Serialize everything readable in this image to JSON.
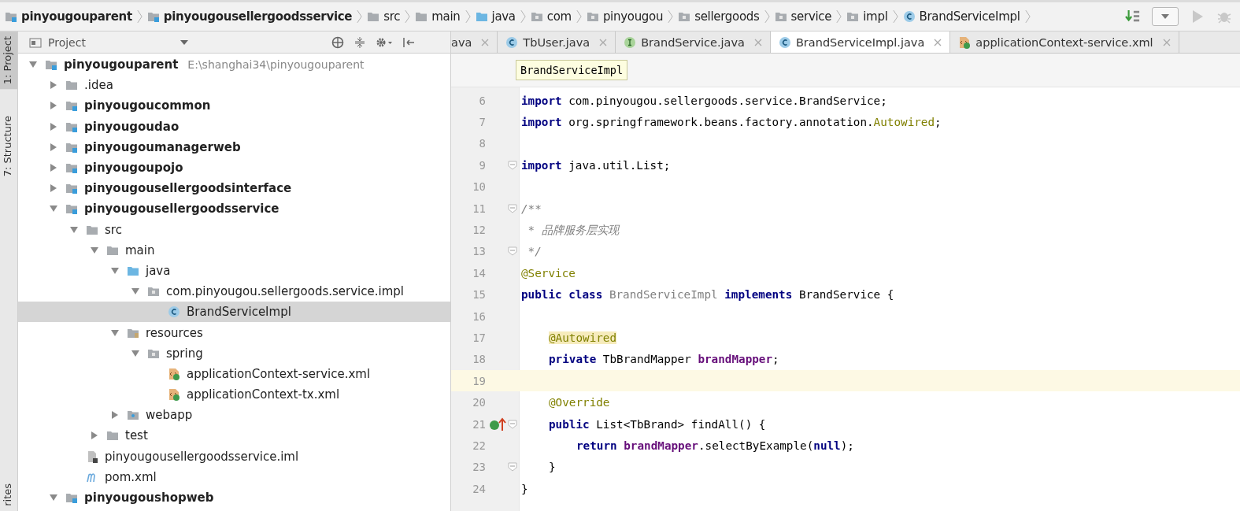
{
  "breadcrumbs": [
    {
      "label": "pinyougouparent",
      "kind": "module",
      "bold": true
    },
    {
      "label": "pinyougousellergoodsservice",
      "kind": "module",
      "bold": true
    },
    {
      "label": "src",
      "kind": "folder",
      "bold": false
    },
    {
      "label": "main",
      "kind": "folder",
      "bold": false
    },
    {
      "label": "java",
      "kind": "source",
      "bold": false
    },
    {
      "label": "com",
      "kind": "package",
      "bold": false
    },
    {
      "label": "pinyougou",
      "kind": "package",
      "bold": false
    },
    {
      "label": "sellergoods",
      "kind": "package",
      "bold": false
    },
    {
      "label": "service",
      "kind": "package",
      "bold": false
    },
    {
      "label": "impl",
      "kind": "package",
      "bold": false
    },
    {
      "label": "BrandServiceImpl",
      "kind": "class",
      "bold": false
    }
  ],
  "side_tool_tabs": [
    {
      "label": "1: Project",
      "selected": true
    },
    {
      "label": "7: Structure",
      "selected": false
    },
    {
      "label": "rites",
      "selected": false
    }
  ],
  "project_panel": {
    "title": "Project"
  },
  "tree": [
    {
      "label": "pinyougouparent",
      "path": "E:\\shanghai34\\pinyougouparent",
      "kind": "module",
      "bold": true,
      "expanded": true,
      "selected": false,
      "children": [
        {
          "label": ".idea",
          "kind": "folder",
          "bold": false,
          "expanded": false,
          "selected": false
        },
        {
          "label": "pinyougoucommon",
          "kind": "module",
          "bold": true,
          "expanded": false,
          "selected": false
        },
        {
          "label": "pinyougoudao",
          "kind": "module",
          "bold": true,
          "expanded": false,
          "selected": false
        },
        {
          "label": "pinyougoumanagerweb",
          "kind": "module",
          "bold": true,
          "expanded": false,
          "selected": false
        },
        {
          "label": "pinyougoupojo",
          "kind": "module",
          "bold": true,
          "expanded": false,
          "selected": false
        },
        {
          "label": "pinyougousellergoodsinterface",
          "kind": "module",
          "bold": true,
          "expanded": false,
          "selected": false
        },
        {
          "label": "pinyougousellergoodsservice",
          "kind": "module",
          "bold": true,
          "expanded": true,
          "selected": false,
          "children": [
            {
              "label": "src",
              "kind": "folder",
              "bold": false,
              "expanded": true,
              "selected": false,
              "children": [
                {
                  "label": "main",
                  "kind": "folder",
                  "bold": false,
                  "expanded": true,
                  "selected": false,
                  "children": [
                    {
                      "label": "java",
                      "kind": "source",
                      "bold": false,
                      "expanded": true,
                      "selected": false,
                      "children": [
                        {
                          "label": "com.pinyougou.sellergoods.service.impl",
                          "kind": "package",
                          "bold": false,
                          "expanded": true,
                          "selected": false,
                          "children": [
                            {
                              "label": "BrandServiceImpl",
                              "kind": "class",
                              "bold": false,
                              "selected": true
                            }
                          ]
                        }
                      ]
                    },
                    {
                      "label": "resources",
                      "kind": "resources",
                      "bold": false,
                      "expanded": true,
                      "selected": false,
                      "children": [
                        {
                          "label": "spring",
                          "kind": "package",
                          "bold": false,
                          "expanded": true,
                          "selected": false,
                          "children": [
                            {
                              "label": "applicationContext-service.xml",
                              "kind": "xml",
                              "bold": false,
                              "selected": false
                            },
                            {
                              "label": "applicationContext-tx.xml",
                              "kind": "xml",
                              "bold": false,
                              "selected": false
                            }
                          ]
                        }
                      ]
                    },
                    {
                      "label": "webapp",
                      "kind": "web",
                      "bold": false,
                      "expanded": false,
                      "selected": false
                    }
                  ]
                },
                {
                  "label": "test",
                  "kind": "folder",
                  "bold": false,
                  "expanded": false,
                  "selected": false
                }
              ]
            },
            {
              "label": "pinyougousellergoodsservice.iml",
              "kind": "iml",
              "bold": false,
              "selected": false
            },
            {
              "label": "pom.xml",
              "kind": "maven",
              "bold": false,
              "selected": false
            }
          ]
        },
        {
          "label": "pinyougoushopweb",
          "kind": "module",
          "bold": true,
          "expanded": true,
          "selected": false
        }
      ]
    }
  ],
  "tabs": [
    {
      "label": "ava",
      "selected": false
    },
    {
      "label": "TbUser.java",
      "kind": "class",
      "selected": false
    },
    {
      "label": "BrandService.java",
      "kind": "interface",
      "selected": false
    },
    {
      "label": "BrandServiceImpl.java",
      "kind": "class",
      "selected": true
    },
    {
      "label": "applicationContext-service.xml",
      "kind": "xml",
      "selected": false
    }
  ],
  "editor_breadcrumb": "BrandServiceImpl",
  "code_lines": [
    {
      "number": "6",
      "kind": "top",
      "fold": false,
      "current": false,
      "gutter_mark": false,
      "tokens": [
        {
          "kind": "keyword",
          "text": "import"
        },
        {
          "kind": "plain",
          "text": " com.pinyougou.sellergoods.service.BrandService;"
        }
      ]
    },
    {
      "number": "7",
      "kind": "top",
      "fold": false,
      "current": false,
      "gutter_mark": false,
      "tokens": [
        {
          "kind": "keyword",
          "text": "import"
        },
        {
          "kind": "plain",
          "text": " org.springframework.beans.factory.annotation."
        },
        {
          "kind": "annotation",
          "text": "Autowired"
        },
        {
          "kind": "plain",
          "text": ";"
        }
      ]
    },
    {
      "number": "8",
      "fold": false,
      "current": false,
      "gutter_mark": false
    },
    {
      "number": "9",
      "kind": "top",
      "fold": true,
      "current": false,
      "gutter_mark": false,
      "tokens": [
        {
          "kind": "keyword",
          "text": "import"
        },
        {
          "kind": "plain",
          "text": " java.util.List;"
        }
      ]
    },
    {
      "number": "10",
      "fold": false,
      "current": false,
      "gutter_mark": false
    },
    {
      "number": "11",
      "kind": "top",
      "fold": true,
      "current": false,
      "gutter_mark": false,
      "tokens": [
        {
          "kind": "comment",
          "text": "/**"
        }
      ]
    },
    {
      "number": "12",
      "kind": "top",
      "fold": false,
      "current": false,
      "gutter_mark": false,
      "tokens": [
        {
          "kind": "comment",
          "text": " * 品牌服务层实现"
        }
      ]
    },
    {
      "number": "13",
      "kind": "top",
      "fold": true,
      "current": false,
      "gutter_mark": false,
      "tokens": [
        {
          "kind": "comment",
          "text": " */"
        }
      ]
    },
    {
      "number": "14",
      "kind": "top",
      "fold": false,
      "current": false,
      "gutter_mark": false,
      "tokens": [
        {
          "kind": "annotation",
          "text": "@Service"
        }
      ]
    },
    {
      "number": "15",
      "kind": "top",
      "fold": false,
      "current": false,
      "gutter_mark": false,
      "tokens": [
        {
          "kind": "keyword",
          "text": "public class"
        },
        {
          "kind": "unused",
          "text": " BrandServiceImpl "
        },
        {
          "kind": "keyword",
          "text": "implements"
        },
        {
          "kind": "plain",
          "text": " BrandService {"
        }
      ]
    },
    {
      "number": "16",
      "fold": false,
      "current": false,
      "gutter_mark": false
    },
    {
      "number": "17",
      "kind": "member",
      "fold": false,
      "current": false,
      "gutter_mark": false,
      "tokens": [
        {
          "kind": "highlighted-annotation",
          "text": "@Autowired"
        }
      ]
    },
    {
      "number": "18",
      "kind": "member",
      "fold": false,
      "current": false,
      "gutter_mark": false,
      "tokens": [
        {
          "kind": "keyword",
          "text": "private"
        },
        {
          "kind": "plain",
          "text": " TbBrandMapper "
        },
        {
          "kind": "field",
          "text": "brandMapper"
        },
        {
          "kind": "plain",
          "text": ";"
        }
      ]
    },
    {
      "number": "19",
      "fold": false,
      "current": true,
      "gutter_mark": false
    },
    {
      "number": "20",
      "kind": "member",
      "fold": false,
      "current": false,
      "gutter_mark": false,
      "tokens": [
        {
          "kind": "annotation",
          "text": "@Override"
        }
      ]
    },
    {
      "number": "21",
      "kind": "member",
      "fold": true,
      "current": false,
      "gutter_mark": true,
      "tokens": [
        {
          "kind": "keyword",
          "text": "public"
        },
        {
          "kind": "plain",
          "text": " List<TbBrand> findAll() {"
        }
      ]
    },
    {
      "number": "22",
      "kind": "statement",
      "fold": false,
      "current": false,
      "gutter_mark": false,
      "tokens": [
        {
          "kind": "keyword",
          "text": "return"
        },
        {
          "kind": "field",
          "text": " brandMapper"
        },
        {
          "kind": "plain",
          "text": ".selectByExample("
        },
        {
          "kind": "keyword",
          "text": "null"
        },
        {
          "kind": "plain",
          "text": ");"
        }
      ]
    },
    {
      "number": "23",
      "kind": "member",
      "fold": true,
      "current": false,
      "gutter_mark": false,
      "tokens": [
        {
          "kind": "plain",
          "text": "}"
        }
      ]
    },
    {
      "number": "24",
      "kind": "top",
      "fold": false,
      "current": false,
      "gutter_mark": false,
      "tokens": [
        {
          "kind": "plain",
          "text": "}"
        }
      ]
    }
  ]
}
